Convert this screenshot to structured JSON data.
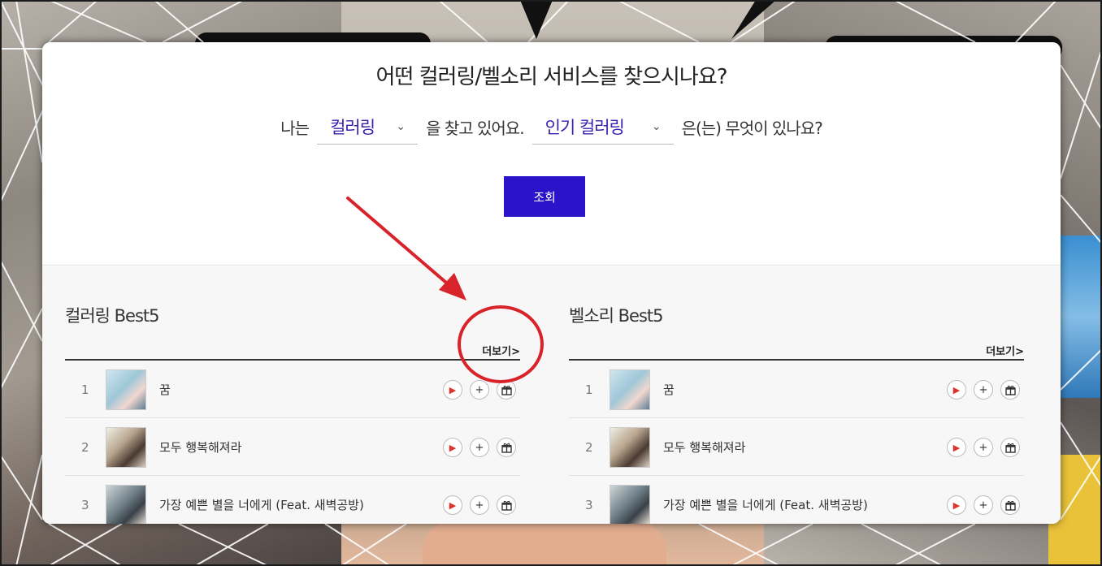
{
  "search": {
    "title": "어떤 컬러링/벨소리 서비스를 찾으시나요?",
    "prefix": "나는",
    "service_select": "컬러링",
    "middle": "을 찾고 있어요.",
    "category_select": "인기 컬러링",
    "suffix": "은(는) 무엇이 있나요?",
    "button": "조회"
  },
  "lists": [
    {
      "title": "컬러링 Best5",
      "more": "더보기>",
      "items": [
        {
          "rank": "1",
          "title": "꿈"
        },
        {
          "rank": "2",
          "title": "모두 행복해져라"
        },
        {
          "rank": "3",
          "title": "가장 예쁜 별을 너에게 (Feat. 새벽공방)"
        }
      ]
    },
    {
      "title": "벨소리 Best5",
      "more": "더보기>",
      "items": [
        {
          "rank": "1",
          "title": "꿈"
        },
        {
          "rank": "2",
          "title": "모두 행복해져라"
        },
        {
          "rank": "3",
          "title": "가장 예쁜 별을 너에게 (Feat. 새벽공방)"
        }
      ]
    }
  ],
  "icons": {
    "play": "▶",
    "add": "+",
    "gift": "🎁"
  },
  "colors": {
    "accent": "#2a13c8",
    "select_text": "#3b1fb0",
    "annotation_red": "#d9232a"
  }
}
